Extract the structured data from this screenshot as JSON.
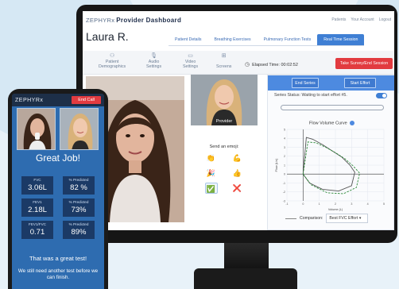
{
  "monitor": {
    "logo_text": "ZEPHYRx",
    "app_title": "Provider Dashboard",
    "top_links": [
      "Patients",
      "Your Account",
      "Logout"
    ],
    "patient_name": "Laura R.",
    "tabs": [
      {
        "label": "Patient Details",
        "active": false
      },
      {
        "label": "Breathing Exercises",
        "active": false
      },
      {
        "label": "Pulmonary Function Tests",
        "active": false
      },
      {
        "label": "Real Time Session",
        "active": true
      }
    ],
    "tools": [
      {
        "label_1": "Patient",
        "label_2": "Demographics",
        "icon": "user-group-icon"
      },
      {
        "label_1": "Audio",
        "label_2": "Settings",
        "icon": "microphone-icon"
      },
      {
        "label_1": "Video",
        "label_2": "Settings",
        "icon": "video-camera-icon"
      },
      {
        "label_1": "",
        "label_2": "Screens",
        "icon": "screens-icon"
      }
    ],
    "elapsed_label": "Elapsed Time: 00:02:52",
    "take_survey_label": "Take Survey/End Session",
    "provider_label": "Provider",
    "emoji_title": "Send an emoji:",
    "emojis": [
      "👏",
      "💪",
      "🎉",
      "👍",
      "✅",
      "❌"
    ],
    "panel": {
      "end_series_label": "End Series",
      "start_effort_label": "Start Effort",
      "status_text": "Series Status: Waiting to start effort #5.",
      "curve_title": "Flow Volume Curve",
      "comparison_label": "Comparison:",
      "comparison_value": "Best FVC Effort"
    }
  },
  "chart_data": {
    "type": "line",
    "title": "Flow Volume Curve",
    "xlabel": "Volume (L)",
    "ylabel": "Flow (L/s)",
    "xlim": [
      -1,
      5
    ],
    "ylim": [
      -3,
      5
    ],
    "x_ticks": [
      -1,
      0,
      1,
      2,
      3,
      4,
      5
    ],
    "y_ticks": [
      -3,
      -2,
      -1,
      0,
      1,
      2,
      3,
      4,
      5
    ],
    "grid": true,
    "series": [
      {
        "name": "",
        "style": "solid",
        "color": "#555555",
        "points": [
          [
            0,
            0
          ],
          [
            0.2,
            4.1
          ],
          [
            0.6,
            3.9
          ],
          [
            1.2,
            3.3
          ],
          [
            1.8,
            2.6
          ],
          [
            2.4,
            1.9
          ],
          [
            2.9,
            1.0
          ],
          [
            3.2,
            0.2
          ],
          [
            3.0,
            -1.3
          ],
          [
            2.2,
            -1.9
          ],
          [
            1.2,
            -1.7
          ],
          [
            0.4,
            -1.0
          ],
          [
            0,
            0
          ]
        ]
      },
      {
        "name": "",
        "style": "dashed",
        "color": "#2e8b3a",
        "points": [
          [
            0,
            0
          ],
          [
            0.3,
            3.6
          ],
          [
            0.8,
            3.5
          ],
          [
            1.4,
            3.0
          ],
          [
            2.0,
            2.4
          ],
          [
            2.6,
            1.7
          ],
          [
            3.1,
            0.9
          ],
          [
            3.5,
            0.1
          ],
          [
            3.3,
            -1.5
          ],
          [
            2.5,
            -2.2
          ],
          [
            1.5,
            -2.1
          ],
          [
            0.5,
            -1.2
          ],
          [
            0,
            0
          ]
        ]
      }
    ]
  },
  "phone": {
    "logo_text": "ZEPHYRx",
    "end_call_label": "End Call",
    "headline": "Great Job!",
    "stats": [
      {
        "label": "FVC",
        "value": "3.06L"
      },
      {
        "label": "% Predicted",
        "value": "82 %"
      },
      {
        "label": "FEV1",
        "value": "2.18L"
      },
      {
        "label": "% Predicted",
        "value": "73%"
      },
      {
        "label": "FEV1/FVC",
        "value": "0.71"
      },
      {
        "label": "% Predicted",
        "value": "89%"
      }
    ],
    "message_1": "That was a great test!",
    "message_2": "We still need another test before we can finish."
  },
  "colors": {
    "accent": "#3f7fd4",
    "danger": "#e23b40",
    "phone_bg": "#2e6cb0"
  }
}
